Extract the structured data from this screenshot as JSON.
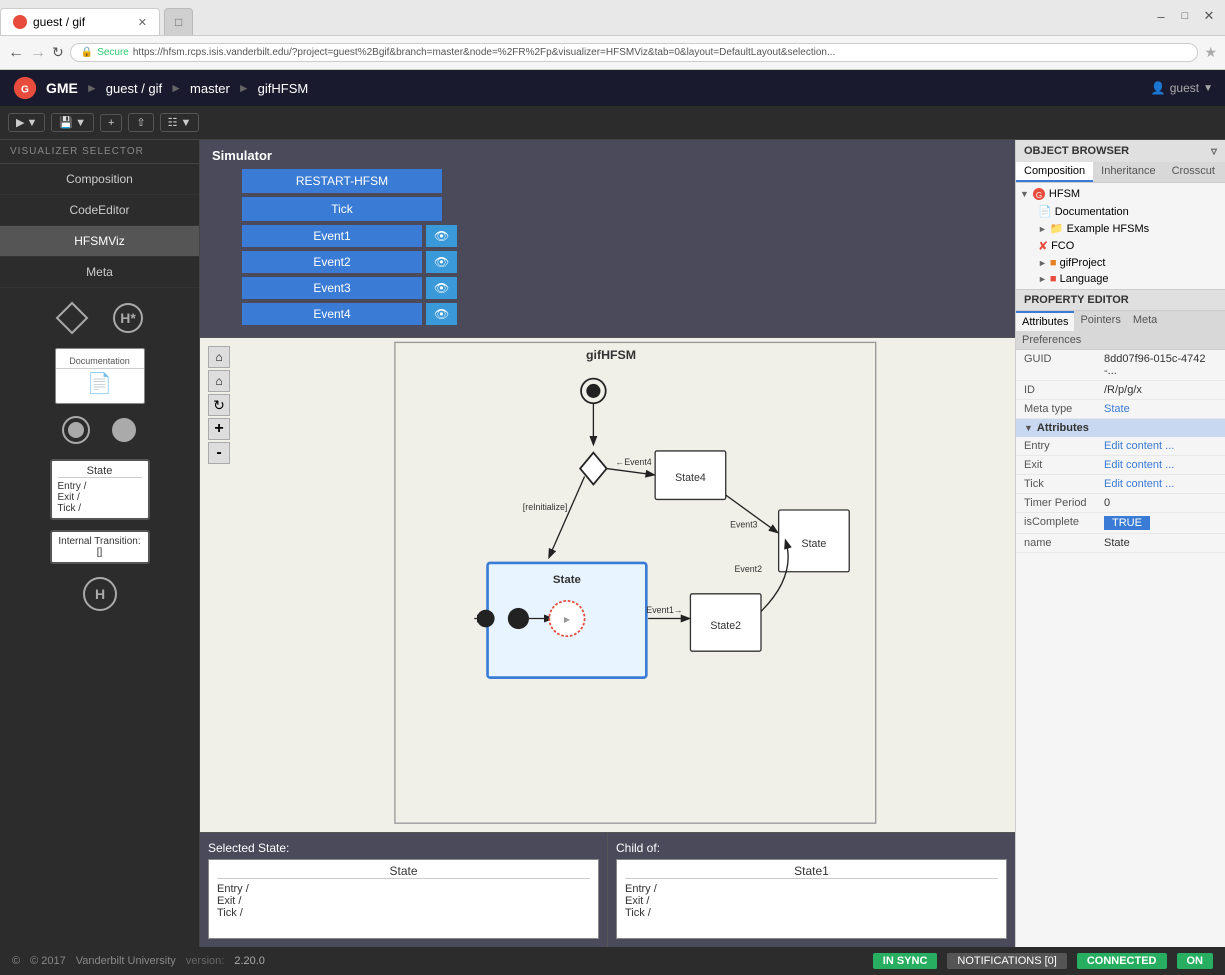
{
  "browser": {
    "tab_title": "guest / gif",
    "url": "https://hfsm.rcps.isis.vanderbilt.edu/?project=guest%2Bgif&branch=master&node=%2FR%2Fp&visualizer=HFSMViz&tab=0&layout=DefaultLayout&selection...",
    "secure_label": "Secure"
  },
  "gme": {
    "title": "GME",
    "breadcrumb": [
      "guest / gif",
      "master",
      "gifHFSM"
    ],
    "user": "guest"
  },
  "toolbar": {
    "play_label": "▶",
    "plus_label": "+",
    "upload_label": "↑",
    "layout_label": "⊞"
  },
  "sidebar": {
    "header": "VISUALIZER SELECTOR",
    "items": [
      {
        "label": "Composition",
        "active": false
      },
      {
        "label": "CodeEditor",
        "active": false
      },
      {
        "label": "HFSMViz",
        "active": true
      },
      {
        "label": "Meta",
        "active": false
      }
    ]
  },
  "simulator": {
    "title": "Simulator",
    "restart_label": "RESTART-HFSM",
    "tick_label": "Tick",
    "events": [
      {
        "label": "Event1"
      },
      {
        "label": "Event2"
      },
      {
        "label": "Event3"
      },
      {
        "label": "Event4"
      }
    ]
  },
  "selected_state": {
    "title": "Selected State:",
    "box_title": "State",
    "entry": "Entry /",
    "exit": "Exit /",
    "tick": "Tick /"
  },
  "child_of": {
    "title": "Child of:",
    "box_title": "State1",
    "entry": "Entry /",
    "exit": "Exit /",
    "tick": "Tick /"
  },
  "canvas": {
    "diagram_title": "gifHFSM",
    "states": [
      {
        "id": "state-main",
        "label": "State",
        "selected": true
      },
      {
        "id": "state2",
        "label": "State2"
      },
      {
        "id": "state4",
        "label": "State4"
      },
      {
        "id": "state-right",
        "label": "State"
      }
    ],
    "transitions": [
      {
        "label": "Event1"
      },
      {
        "label": "Event2"
      },
      {
        "label": "Event3"
      },
      {
        "label": "Event4"
      },
      {
        "label": "[reInitialize]"
      }
    ]
  },
  "object_browser": {
    "header": "OBJECT BROWSER",
    "tabs": [
      "Composition",
      "Inheritance",
      "Crosscut"
    ],
    "tree": [
      {
        "label": "HFSM",
        "icon": "expand",
        "children": [
          {
            "label": "Documentation"
          },
          {
            "label": "Example HFSMs",
            "icon": "expand"
          },
          {
            "label": "FCO",
            "icon": "fco"
          },
          {
            "label": "gifProject",
            "icon": "expand"
          },
          {
            "label": "Language",
            "icon": "expand"
          }
        ]
      }
    ]
  },
  "property_editor": {
    "header": "PROPERTY EDITOR",
    "tabs": [
      "Attributes",
      "Pointers",
      "Meta",
      "Preferences"
    ],
    "active_tab": "Attributes",
    "rows": [
      {
        "key": "GUID",
        "value": "8dd07f96-015c-4742-..."
      },
      {
        "key": "ID",
        "value": "/R/p/g/x"
      },
      {
        "key": "Meta type",
        "value": "State",
        "is_link": true
      }
    ],
    "attributes_section": "Attributes",
    "attribute_rows": [
      {
        "key": "Entry",
        "value": "Edit content ..."
      },
      {
        "key": "Exit",
        "value": "Edit content ..."
      },
      {
        "key": "Tick",
        "value": "Edit content ..."
      },
      {
        "key": "Timer Period",
        "value": "0"
      },
      {
        "key": "isComplete",
        "value": "TRUE",
        "is_badge": true
      },
      {
        "key": "name",
        "value": "State"
      }
    ]
  },
  "status_bar": {
    "year": "© 2017",
    "company": "Vanderbilt University",
    "version_label": "version:",
    "version": "2.20.0",
    "in_sync": "IN SYNC",
    "notifications": "NOTIFICATIONS [0]",
    "connected": "CONNECTED",
    "on": "ON"
  },
  "palette": {
    "diamond_label": "",
    "history_label": "",
    "doc_label": "Documentation",
    "initial_state_label": "",
    "end_state_label": "",
    "state_label": "State",
    "internal_trans_label": "Internal Transition:",
    "history_deep_label": ""
  }
}
